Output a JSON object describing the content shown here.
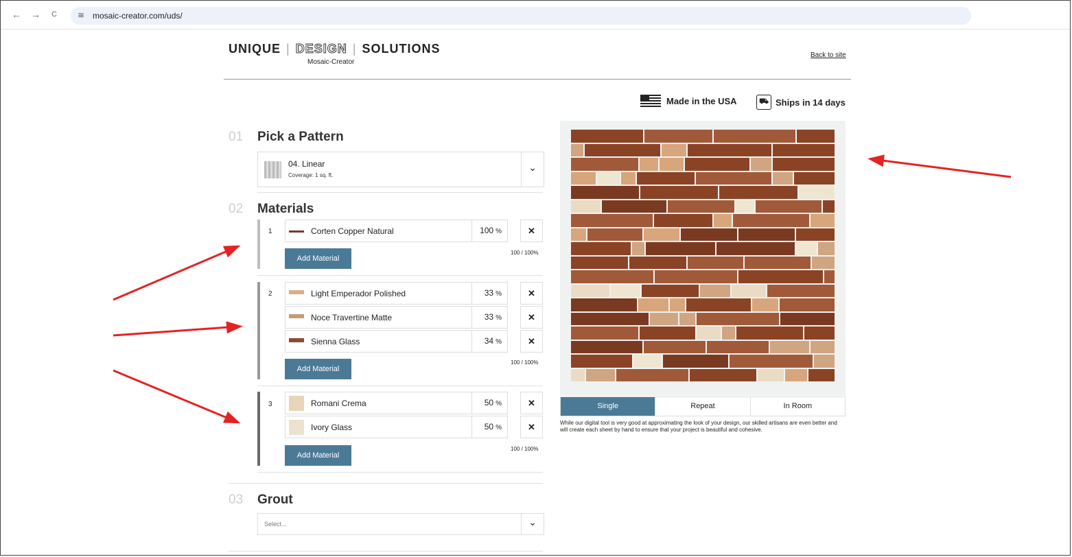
{
  "browser": {
    "back_icon": "←",
    "forward_icon": "→",
    "reload_icon": "C",
    "site_icon": "≅",
    "url": "mosaic-creator.com/uds/"
  },
  "header": {
    "brand_unique": "UNIQUE",
    "brand_sep": "|",
    "brand_design": "DESIGN",
    "brand_solutions": "SOLUTIONS",
    "sub_brand": "Mosaic-Creator",
    "back_link": "Back to site"
  },
  "badges": {
    "made_usa": "Made in the USA",
    "ships": "Ships in 14 days"
  },
  "pattern": {
    "num": "01",
    "title": "Pick a Pattern",
    "name": "04. Linear",
    "coverage": "Coverage: 1 sq. ft.",
    "chevron": "⌄"
  },
  "materials": {
    "num": "02",
    "title": "Materials",
    "add_label": "Add Material",
    "pct_sign": "%",
    "delete_icon": "✕",
    "groups": [
      {
        "index": "1",
        "bar_color": "#bdbdbd",
        "total": "100 / 100%",
        "items": [
          {
            "name": "Corten Copper Natural",
            "pct": "100",
            "swatch": "#7a3b24"
          }
        ]
      },
      {
        "index": "2",
        "bar_color": "#9a9a9a",
        "total": "100 / 100%",
        "items": [
          {
            "name": "Light Emperador Polished",
            "pct": "33",
            "swatch": "#d6b08a"
          },
          {
            "name": "Noce Travertine Matte",
            "pct": "33",
            "swatch": "#c99b73"
          },
          {
            "name": "Sienna Glass",
            "pct": "34",
            "swatch": "#8a4b33"
          }
        ]
      },
      {
        "index": "3",
        "bar_color": "#6a6a6a",
        "total": "100%",
        "total_full": "100 / 100%",
        "items": [
          {
            "name": "Romani Crema",
            "pct": "50",
            "swatch": "#e8d5b8"
          },
          {
            "name": "Ivory Glass",
            "pct": "50",
            "swatch": "#ece3cf"
          }
        ]
      }
    ]
  },
  "grout": {
    "num": "03",
    "title": "Grout",
    "placeholder": "Select...",
    "chevron": "⌄"
  },
  "preview": {
    "tabs": [
      "Single",
      "Repeat",
      "In Room"
    ],
    "active_tab": "Single",
    "disclaimer": "While our digital tool is very good at approximating the look of your design, our skilled artisans are even better and will create each sheet by hand to ensure that your project is beautiful and cohesive.",
    "colors": {
      "corten": "#8b4326",
      "corten_dark": "#7a3a22",
      "sienna": "#a05a3a",
      "emperador": "#d7a67c",
      "travertine": "#cfa582",
      "crema": "#eadbc4",
      "ivory": "#efe6d2"
    }
  },
  "annotations": {
    "arrow_color": "#e52222"
  }
}
